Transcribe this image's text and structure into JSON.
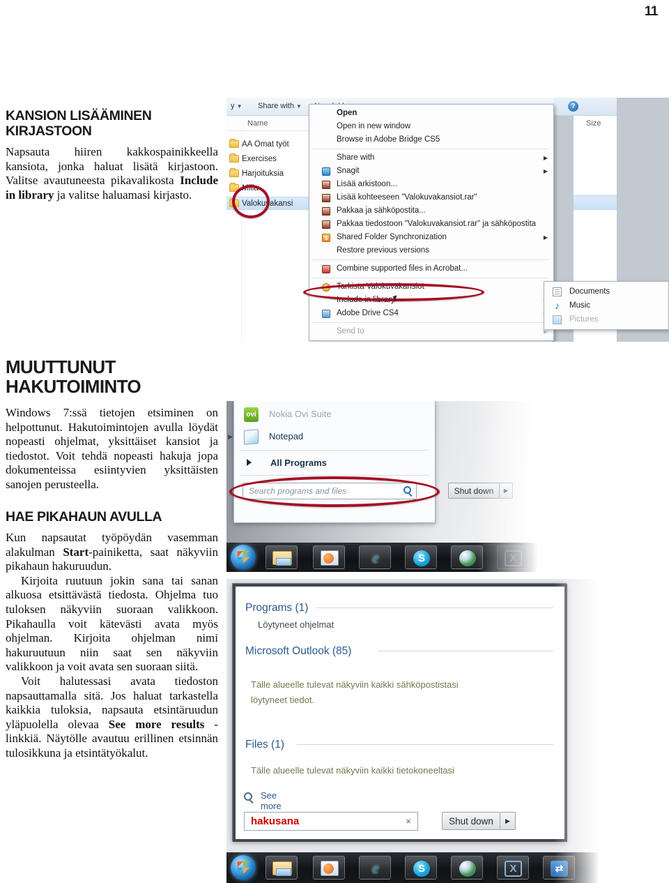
{
  "page": {
    "number": "11"
  },
  "article": {
    "section1": {
      "heading_line1": "KANSION LISÄÄMINEN",
      "heading_line2": "KIRJASTOON",
      "paragraph_a": "Napsauta hiiren kakkospainikkeella kansiota, jonka haluat lisätä kirjastoon. Valitse avautuneesta pikavalikosta ",
      "paragraph_a_bold": "Include in library",
      "paragraph_a_tail": " ja valitse haluamasi kirjasto."
    },
    "section2": {
      "heading": "MUUTTUNUT HAKUTOIMINTO",
      "paragraph_a": "Windows 7:ssä tietojen etsiminen on helpottunut. Hakutoimintojen avulla löydät nopeasti ohjelmat, yksittäiset kansiot ja tiedostot. Voit tehdä nopeasti hakuja jopa dokumenteissa esiintyvien yksittäisten sanojen perusteella."
    },
    "section3": {
      "heading": "HAE PIKAHAUN AVULLA",
      "paragraph_a_pre": "Kun napsautat työpöydän vasemman alakulman ",
      "paragraph_a_bold": "Start",
      "paragraph_a_post": "-painiketta, saat näkyviin pikahaun hakuruudun.",
      "paragraph_b": "Kirjoita ruutuun jokin sana tai sanan alkuosa etsittävästä tiedosta. Ohjelma tuo tuloksen näkyviin suoraan valikkoon. Pikahaulla voit kätevästi avata myös ohjelman. Kirjoita ohjelman nimi hakuruutuun niin saat sen näkyviin valikkoon ja voit avata sen suoraan siitä.",
      "paragraph_c_pre": "Voit halutessasi avata tiedoston napsauttamalla sitä. Jos haluat tarkastella kaikkia tuloksia, napsauta etsintäruudun yläpuolella olevaa ",
      "paragraph_c_bold": "See more results",
      "paragraph_c_post": " -linkkiä. Näytölle avautuu erillinen etsinnän tulosikkuna ja etsintätyökalut."
    }
  },
  "screenshot1": {
    "toolbar": {
      "library_label": "y",
      "share_with": "Share with",
      "new_folder": "New folder"
    },
    "column_headers": {
      "name": "Name",
      "size": "Size"
    },
    "folders": [
      "AA Omat työt",
      "Exercises",
      "Harjoituksia",
      "Milla",
      "Valokuvakansi"
    ],
    "context_menu": [
      {
        "label": "Open",
        "bold": true,
        "icon": "none",
        "arrow": false,
        "dim": false
      },
      {
        "label": "Open in new window",
        "bold": false,
        "icon": "none",
        "arrow": false,
        "dim": false
      },
      {
        "label": "Browse in Adobe Bridge CS5",
        "bold": false,
        "icon": "none",
        "arrow": false,
        "dim": false
      },
      {
        "label": "Share with",
        "bold": false,
        "icon": "none",
        "arrow": true,
        "dim": false
      },
      {
        "label": "Snagit",
        "bold": false,
        "icon": "snagit",
        "arrow": true,
        "dim": false
      },
      {
        "label": "Lisää arkistoon...",
        "bold": false,
        "icon": "winrar",
        "arrow": false,
        "dim": false
      },
      {
        "label": "Lisää kohteeseen \"Valokuvakansiot.rar\"",
        "bold": false,
        "icon": "winrar",
        "arrow": false,
        "dim": false
      },
      {
        "label": "Pakkaa ja sähköpostita...",
        "bold": false,
        "icon": "winrar",
        "arrow": false,
        "dim": false
      },
      {
        "label": "Pakkaa tiedostoon \"Valokuvakansiot.rar\" ja sähköpostita",
        "bold": false,
        "icon": "winrar",
        "arrow": false,
        "dim": false
      },
      {
        "label": "Shared Folder Synchronization",
        "bold": false,
        "icon": "orange",
        "arrow": true,
        "dim": false
      },
      {
        "label": "Restore previous versions",
        "bold": false,
        "icon": "none",
        "arrow": false,
        "dim": false
      },
      {
        "label": "Combine supported files in Acrobat...",
        "bold": false,
        "icon": "acro",
        "arrow": false,
        "dim": false
      },
      {
        "label": "Tarkista Valokuvakansiot",
        "bold": false,
        "icon": "gold",
        "arrow": false,
        "dim": false
      },
      {
        "label": "Include in library",
        "bold": false,
        "icon": "none",
        "arrow": true,
        "dim": false
      },
      {
        "label": "Adobe Drive CS4",
        "bold": false,
        "icon": "adobe",
        "arrow": true,
        "dim": false
      },
      {
        "label": "Send to",
        "bold": false,
        "icon": "none",
        "arrow": true,
        "dim": true
      }
    ],
    "submenu": [
      {
        "label": "Documents",
        "icon": "doc",
        "dim": false
      },
      {
        "label": "Music",
        "icon": "music",
        "dim": false
      },
      {
        "label": "Pictures",
        "icon": "pic",
        "dim": true
      }
    ],
    "help_icon": "?"
  },
  "screenshot2": {
    "items": [
      {
        "label": "Nokia Ovi Suite",
        "icon": "ovi-icon",
        "arrow": false,
        "dim": true
      },
      {
        "label": "Notepad",
        "icon": "notepad-icon",
        "arrow": true,
        "dim": false
      }
    ],
    "all_programs": "All Programs",
    "search_placeholder": "Search programs and files",
    "shutdown_label": "Shut down",
    "taskbar_icons": [
      "start-orb-icon",
      "explorer-icon",
      "media-player-icon",
      "internet-explorer-icon",
      "skype-icon",
      "globe-icon",
      "x-app-icon"
    ]
  },
  "screenshot3": {
    "groups": [
      {
        "heading": "Programs (1)",
        "sub": "Löytyneet ohjelmat",
        "note": ""
      },
      {
        "heading": "Microsoft Outlook (85)",
        "sub": "",
        "note_line1": "Tälle alueelle tulevat näkyviin kaikki sähköpostistasi",
        "note_line2": "löytyneet tiedot."
      },
      {
        "heading": "Files (1)",
        "sub": "",
        "note_line1": "Tälle alueelle tulevat näkyviin kaikki tietokoneeltasi"
      }
    ],
    "see_more_results": "See more results",
    "search_value": "hakusana",
    "clear_icon": "×",
    "shutdown_label": "Shut down",
    "taskbar_icons": [
      "start-orb-icon",
      "explorer-icon",
      "media-player-icon",
      "internet-explorer-icon",
      "skype-icon",
      "globe-icon",
      "x-app-icon",
      "blue-app-icon"
    ]
  },
  "colors": {
    "annotation_red": "#a51024",
    "heading_black": "#1a1a1a",
    "search_text_red": "#cc0000",
    "result_heading_blue": "#2c5a8f"
  }
}
